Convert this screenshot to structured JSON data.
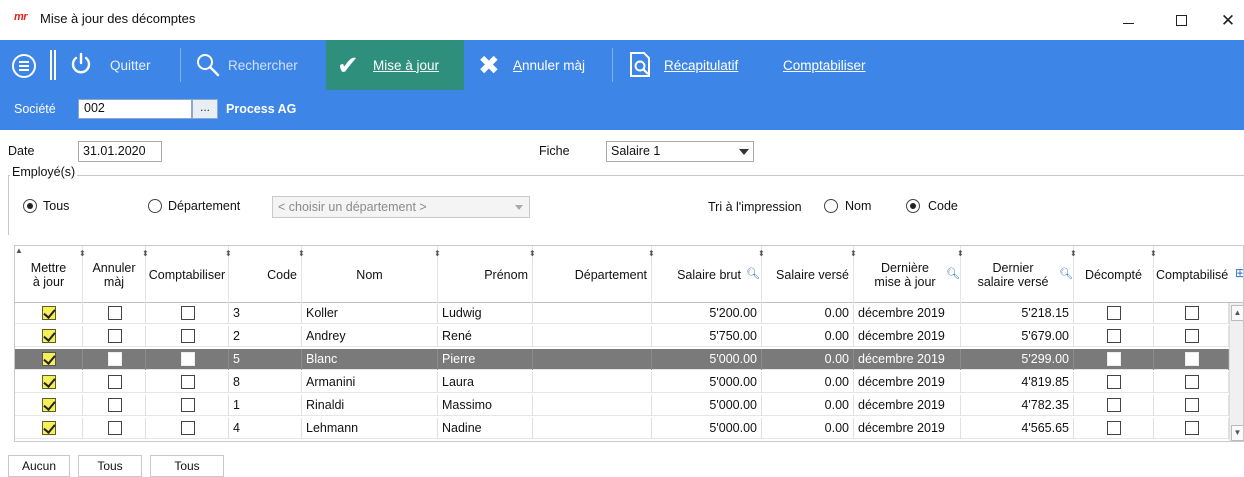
{
  "window": {
    "logo": "mr",
    "title": "Mise à jour des décomptes",
    "controls": {
      "minimize": "minimize-icon",
      "maximize": "maximize-icon",
      "close": "close-icon"
    }
  },
  "toolbar": {
    "quit_label": "Quitter",
    "search_label": "Rechercher",
    "update_label": "Mise à jour",
    "cancel_prefix": "A",
    "cancel_rest": "nnuler màj",
    "recap_label": "Récapitulatif",
    "post_label": "Comptabiliser",
    "colors": {
      "toolbar_bg": "#3d86e8",
      "active_bg": "#2e8f7c"
    }
  },
  "company": {
    "label": "Société",
    "code": "002",
    "lookup": "...",
    "name": "Process AG"
  },
  "form": {
    "date_label": "Date",
    "date_value": "31.01.2020",
    "fiche_label": "Fiche",
    "fiche_value": "Salaire 1",
    "employees_group": "Employé(s)",
    "radio_all": "Tous",
    "radio_department": "Département",
    "department_placeholder": "< choisir un département >",
    "sort_label": "Tri à l'impression",
    "sort_name": "Nom",
    "sort_code": "Code"
  },
  "grid": {
    "headers": {
      "update": "Mettre à jour",
      "cancel": "Annuler màj",
      "post": "Comptabiliser",
      "code": "Code",
      "last_name": "Nom",
      "first_name": "Prénom",
      "department": "Département",
      "gross": "Salaire brut",
      "paid": "Salaire versé",
      "last_update": "Dernière mise à jour",
      "last_paid": "Dernier salaire versé",
      "calculated": "Décompté",
      "posted": "Comptabilisé"
    },
    "rows": [
      {
        "update": true,
        "code": "3",
        "last_name": "Koller",
        "first_name": "Ludwig",
        "department": "",
        "gross": "5'200.00",
        "paid": "0.00",
        "last_update": "décembre 2019",
        "last_paid": "5'218.15",
        "selected": false
      },
      {
        "update": true,
        "code": "2",
        "last_name": "Andrey",
        "first_name": "René",
        "department": "",
        "gross": "5'750.00",
        "paid": "0.00",
        "last_update": "décembre 2019",
        "last_paid": "5'679.00",
        "selected": false
      },
      {
        "update": true,
        "code": "5",
        "last_name": "Blanc",
        "first_name": "Pierre",
        "department": "",
        "gross": "5'000.00",
        "paid": "0.00",
        "last_update": "décembre 2019",
        "last_paid": "5'299.00",
        "selected": true
      },
      {
        "update": true,
        "code": "8",
        "last_name": "Armanini",
        "first_name": "Laura",
        "department": "",
        "gross": "5'000.00",
        "paid": "0.00",
        "last_update": "décembre 2019",
        "last_paid": "4'819.85",
        "selected": false
      },
      {
        "update": true,
        "code": "1",
        "last_name": "Rinaldi",
        "first_name": "Massimo",
        "department": "",
        "gross": "5'000.00",
        "paid": "0.00",
        "last_update": "décembre 2019",
        "last_paid": "4'782.35",
        "selected": false
      },
      {
        "update": true,
        "code": "4",
        "last_name": "Lehmann",
        "first_name": "Nadine",
        "department": "",
        "gross": "5'000.00",
        "paid": "0.00",
        "last_update": "décembre 2019",
        "last_paid": "4'565.65",
        "selected": false
      }
    ]
  },
  "bottom_buttons": {
    "none": "Aucun",
    "all_1": "Tous",
    "all_2": "Tous"
  }
}
